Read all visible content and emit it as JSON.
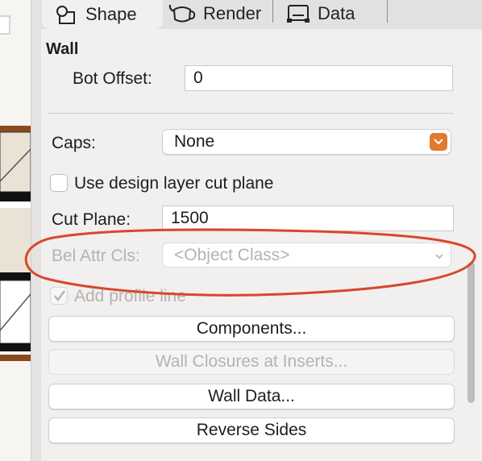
{
  "tabs": [
    {
      "label": "Shape",
      "icon": "shape-icon"
    },
    {
      "label": "Render",
      "icon": "render-teapot-icon"
    },
    {
      "label": "Data",
      "icon": "data-icon"
    }
  ],
  "section_title": "Wall",
  "bot_offset": {
    "label": "Bot Offset:",
    "value": "0"
  },
  "caps": {
    "label": "Caps:",
    "value": "None"
  },
  "use_design_layer": {
    "label": "Use design layer cut plane",
    "checked": false
  },
  "cut_plane": {
    "label": "Cut Plane:",
    "value": "1500"
  },
  "bel_attr": {
    "label": "Bel Attr Cls:",
    "value": "<Object Class>"
  },
  "add_profile": {
    "label": "Add profile line",
    "checked": true
  },
  "buttons": {
    "components": "Components...",
    "wall_closures": "Wall Closures at Inserts...",
    "wall_data": "Wall Data...",
    "reverse_sides": "Reverse Sides"
  },
  "annotation_color": "#d9472b",
  "accent_color": "#e07a2e"
}
